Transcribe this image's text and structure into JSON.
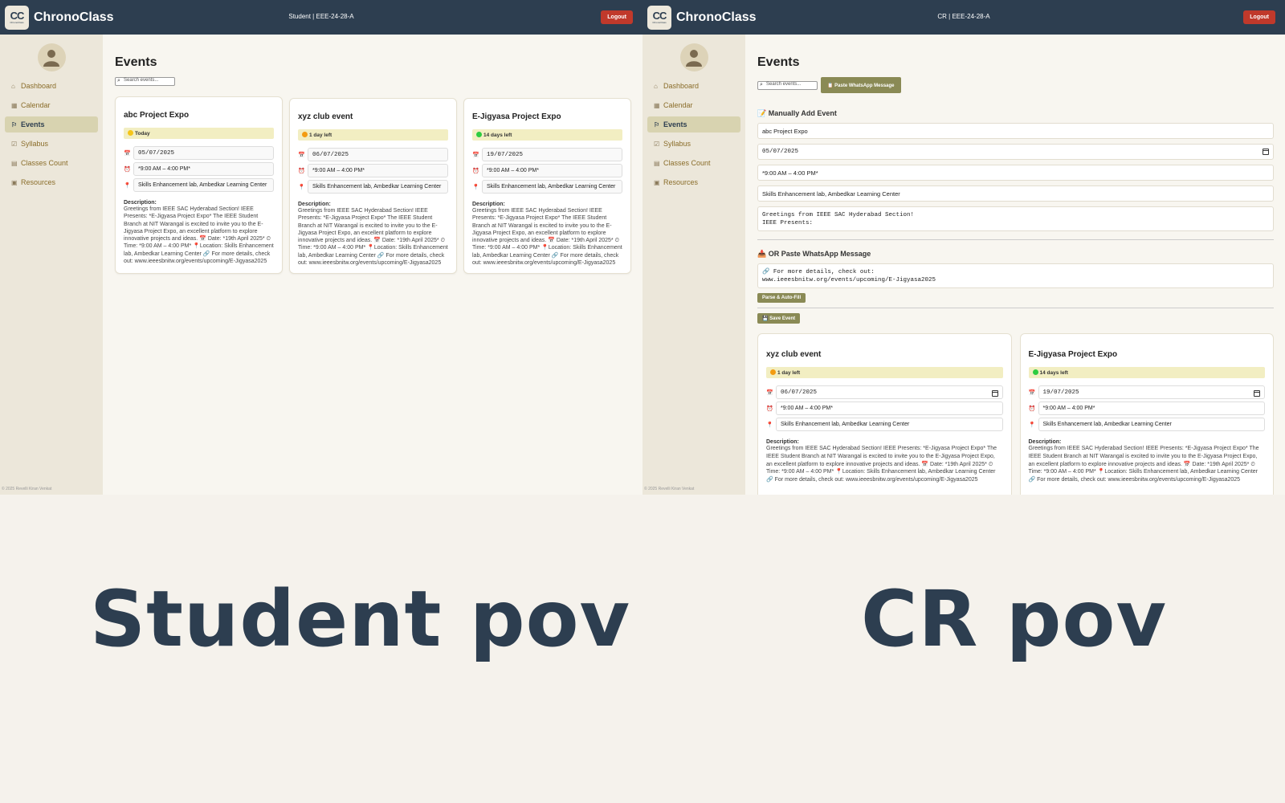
{
  "app": {
    "brand": "ChronoClass",
    "logo_text": "CC",
    "logo_subtext": "ChronoClass",
    "logout_label": "Logout"
  },
  "nav": [
    {
      "label": "Dashboard",
      "icon": "home-icon"
    },
    {
      "label": "Calendar",
      "icon": "calendar-icon"
    },
    {
      "label": "Events",
      "icon": "flag-icon"
    },
    {
      "label": "Syllabus",
      "icon": "book-icon"
    },
    {
      "label": "Classes Count",
      "icon": "clipboard-icon"
    },
    {
      "label": "Resources",
      "icon": "folder-icon"
    }
  ],
  "copyright": "© 2025 Revelli Kiran Venkat",
  "description_label": "Description:",
  "shared_description": "Greetings from IEEE SAC Hyderabad Section! IEEE Presents: *E-Jigyasa Project Expo* The IEEE Student Branch at NIT Warangal is excited to invite you to the E-Jigyasa Project Expo, an excellent platform to explore innovative projects and ideas. 📅 Date: *19th April 2025* ⏲ Time: *9:00 AM – 4:00 PM* 📍Location: Skills Enhancement lab, Ambedkar Learning Center 🔗 For more details, check out: www.ieeesbnitw.org/events/upcoming/E-Jigyasa2025",
  "student": {
    "role": "Student | EEE-24-28-A",
    "title": "Events",
    "search_placeholder": "Search events...",
    "events": [
      {
        "name": "abc Project Expo",
        "badge": "Today",
        "badge_color": "#f5c518",
        "date": "05/07/2025",
        "time": "*9:00 AM – 4:00 PM*",
        "location": "Skills Enhancement lab, Ambedkar Learning Center"
      },
      {
        "name": "xyz club event",
        "badge": "1 day left",
        "badge_color": "#f39c12",
        "date": "06/07/2025",
        "time": "*9:00 AM – 4:00 PM*",
        "location": "Skills Enhancement lab, Ambedkar Learning Center"
      },
      {
        "name": "E-Jigyasa Project Expo",
        "badge": "14 days left",
        "badge_color": "#2ecc40",
        "date": "19/07/2025",
        "time": "*9:00 AM – 4:00 PM*",
        "location": "Skills Enhancement lab, Ambedkar Learning Center"
      }
    ]
  },
  "cr": {
    "role": "CR | EEE-24-28-A",
    "title": "Events",
    "search_placeholder": "Search events...",
    "paste_button": "Paste WhatsApp Message",
    "manual_title": "Manually Add Event",
    "form": {
      "name": "abc Project Expo",
      "date": "05/07/2025",
      "time": "*9:00 AM – 4:00 PM*",
      "location": "Skills Enhancement lab, Ambedkar Learning Center",
      "description": "Greetings from IEEE SAC Hyderabad Section!\nIEEE Presents:"
    },
    "paste_title": "OR Paste WhatsApp Message",
    "paste_text": "🔗 For more details, check out:\nwww.ieeesbnitw.org/events/upcoming/E-Jigyasa2025",
    "parse_button": "Parse & Auto-Fill",
    "save_button": "💾 Save Event",
    "events": [
      {
        "name": "xyz club event",
        "badge": "1 day left",
        "badge_color": "#f39c12",
        "date": "06/07/2025",
        "time": "*9:00 AM – 4:00 PM*",
        "location": "Skills Enhancement lab, Ambedkar Learning Center"
      },
      {
        "name": "E-Jigyasa Project Expo",
        "badge": "14 days left",
        "badge_color": "#2ecc40",
        "date": "19/07/2025",
        "time": "*9:00 AM – 4:00 PM*",
        "location": "Skills Enhancement lab, Ambedkar Learning Center"
      }
    ]
  },
  "captions": {
    "left": "Student pov",
    "right": "CR pov"
  }
}
